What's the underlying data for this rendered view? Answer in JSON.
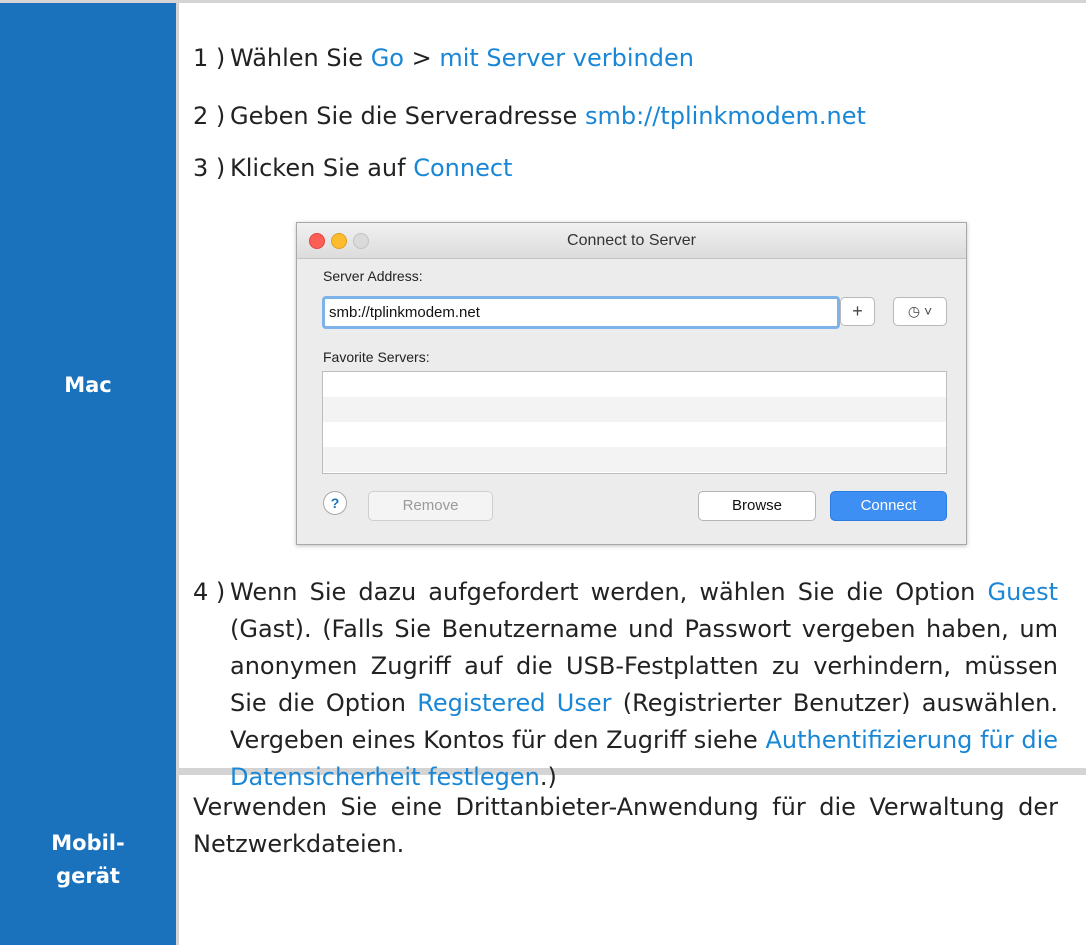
{
  "headers": {
    "mac": "Mac",
    "mobile_line1": "Mobil-",
    "mobile_line2": "gerät"
  },
  "steps": {
    "s1": {
      "num": "1 )",
      "pre": "Wählen Sie ",
      "link1": "Go",
      "mid": " > ",
      "link2": "mit Server verbinden"
    },
    "s2": {
      "num": "2 )",
      "pre": "Geben Sie die Serveradresse ",
      "link": "smb://tplinkmodem.net"
    },
    "s3": {
      "num": "3 )",
      "pre": "Klicken Sie auf ",
      "link": "Connect"
    },
    "s4": {
      "num": "4 )",
      "t1": "Wenn Sie dazu aufgefordert werden, wählen Sie die Option ",
      "link1": "Guest",
      "t2": " (Gast). (Falls Sie Benutzername und Passwort vergeben haben, um anonymen Zugriff auf die USB-Festplatten zu verhindern, müssen Sie die Option ",
      "link2": "Registered User",
      "t3": " (Registrierter Benutzer) auswählen. Vergeben eines Kontos für den Zugriff siehe ",
      "link3": "Authentifizierung für die Datensicherheit festlegen",
      "t4": ".)"
    }
  },
  "mobile_text": "Verwenden Sie eine Drittanbieter-Anwendung für die Verwaltung der Netzwerkdateien.",
  "dialog": {
    "title": "Connect to Server",
    "server_address_label": "Server Address:",
    "server_address_value": "smb://tplinkmodem.net",
    "plus_label": "+",
    "recent_label": "◷ ˅",
    "favorites_label": "Favorite Servers:",
    "help_label": "?",
    "remove_label": "Remove",
    "browse_label": "Browse",
    "connect_label": "Connect"
  },
  "colors": {
    "header_blue": "#1a72bd",
    "link_blue": "#1a87d6",
    "connect_button": "#3d8ff3"
  }
}
